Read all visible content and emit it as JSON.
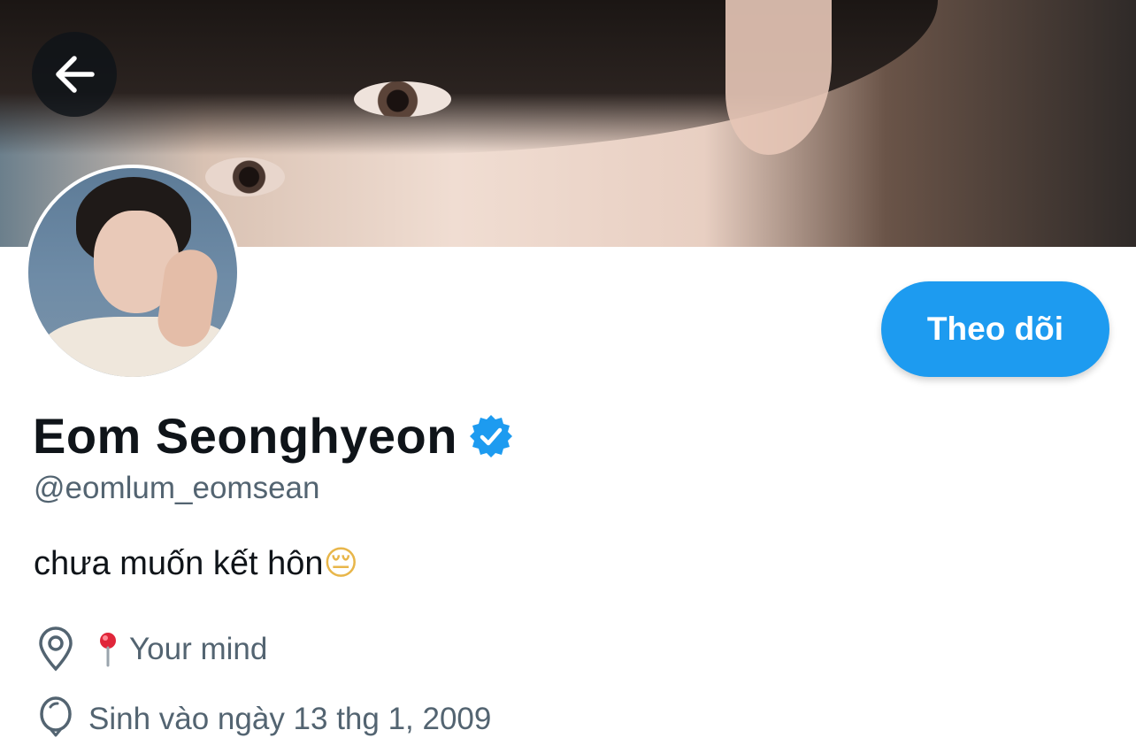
{
  "profile": {
    "name": "Eom Seonghyeon",
    "handle": "@eomlum_eomsean",
    "bio": "chưa muốn kết hôn",
    "bio_emoji": "😔",
    "location": "Your mind",
    "birthday": "Sinh vào ngày 13 thg 1, 2009",
    "verified": true
  },
  "actions": {
    "follow_label": "Theo dõi"
  },
  "icons": {
    "back": "arrow-left-icon",
    "verified": "verified-badge-icon",
    "location": "location-pin-icon",
    "location_emoji": "round-pushpin-emoji",
    "birthday": "balloon-icon"
  },
  "colors": {
    "accent": "#1d9bf0",
    "text_primary": "#0f1419",
    "text_secondary": "#536471"
  }
}
